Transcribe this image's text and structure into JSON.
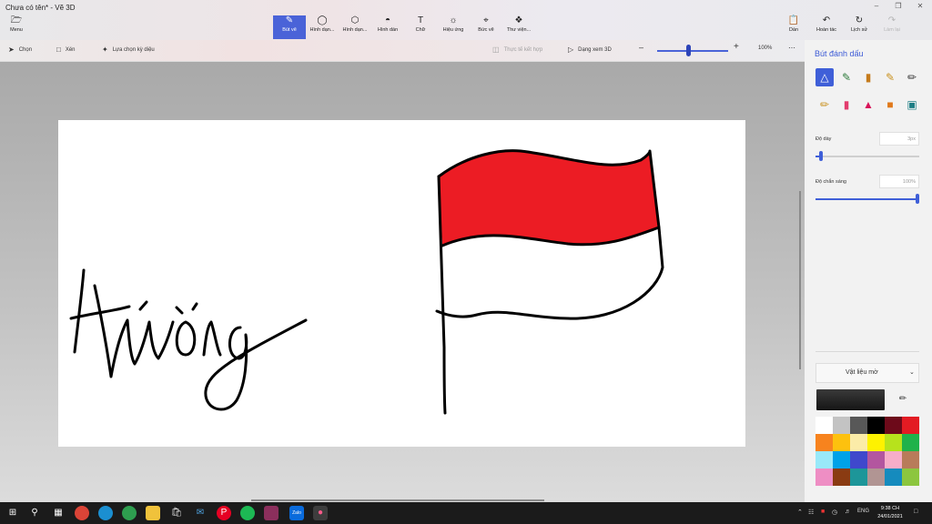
{
  "window": {
    "title": "Chưa có tên* - Vẽ 3D"
  },
  "toolbar": {
    "menu_label": "Menu",
    "tools": [
      {
        "label": "Bút vẽ",
        "icon": "brush-icon"
      },
      {
        "label": "Hình dạn...",
        "icon": "2d-shapes-icon"
      },
      {
        "label": "Hình dạn...",
        "icon": "3d-shapes-icon"
      },
      {
        "label": "Hình dán",
        "icon": "stickers-icon"
      },
      {
        "label": "Chữ",
        "icon": "text-icon"
      },
      {
        "label": "Hiệu ứng",
        "icon": "effects-icon"
      },
      {
        "label": "Bức vẽ",
        "icon": "canvas-icon"
      },
      {
        "label": "Thư viện...",
        "icon": "library-icon"
      }
    ],
    "paste_label": "Dán",
    "undo_label": "Hoàn tác",
    "history_label": "Lịch sử",
    "redo_label": "Làm lại"
  },
  "subtoolbar": {
    "select_label": "Chọn",
    "crop_label": "Xén",
    "magic_select_label": "Lựa chọn kỳ diệu",
    "mixed_reality_label": "Thực tế kết hợp",
    "view_3d_label": "Dạng xem 3D",
    "zoom_level": "100%",
    "zoom_position": 0.43
  },
  "panel": {
    "title": "Bút đánh dấu",
    "brushes": [
      "marker-icon",
      "calligraphy-pen-icon",
      "oil-brush-icon",
      "watercolor-icon",
      "pixel-pen-icon",
      "pencil-icon",
      "eraser-icon",
      "crayon-icon",
      "spraycan-icon",
      "fill-icon"
    ],
    "thickness_label": "Độ dày",
    "thickness_value": "3px",
    "thickness_fraction": 0.05,
    "opacity_label": "Độ chắn sáng",
    "opacity_value": "100%",
    "opacity_fraction": 1.0,
    "material_label": "Vật liệu mờ",
    "palette": [
      "#ffffff",
      "#c3c3c3",
      "#585858",
      "#000000",
      "#6d0a1a",
      "#e31b23",
      "#f7831e",
      "#fdc10e",
      "#fbeca8",
      "#fef200",
      "#b7e21c",
      "#1fb24a",
      "#99e9f9",
      "#00a2e8",
      "#3f48cc",
      "#b3569f",
      "#f6adc9",
      "#b87b5a",
      "#ee8ec4",
      "#8a3b12",
      "#1d9699",
      "#b19593",
      "#158bbe",
      "#8cc63f"
    ]
  },
  "canvas": {
    "signature_text": "Hường"
  },
  "taskbar": {
    "apps": [
      "windows-start-icon",
      "search-icon",
      "task-view-icon",
      "chrome-icon",
      "edge-icon",
      "browser-icon",
      "file-explorer-icon",
      "store-icon",
      "mail-icon",
      "pinterest-icon",
      "spotify-icon",
      "winrar-icon",
      "zalo-icon",
      "paint3d-icon"
    ],
    "lang": "ENG",
    "time": "9:38 CH",
    "date": "24/01/2021"
  }
}
